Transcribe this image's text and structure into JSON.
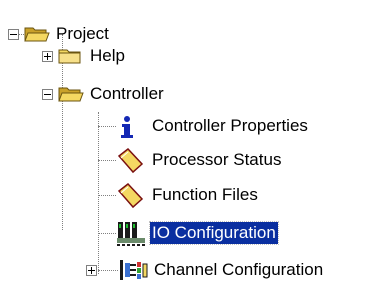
{
  "tree": {
    "project": {
      "label": "Project",
      "icon": "folder-open-icon",
      "expanded": true
    },
    "help": {
      "label": "Help",
      "icon": "folder-icon",
      "expanded": false
    },
    "controller": {
      "label": "Controller",
      "icon": "folder-open-icon",
      "expanded": true
    },
    "items": [
      {
        "label": "Controller Properties",
        "icon": "info-icon"
      },
      {
        "label": "Processor Status",
        "icon": "document-diamond-icon"
      },
      {
        "label": "Function Files",
        "icon": "document-diamond-icon"
      },
      {
        "label": "IO Configuration",
        "icon": "io-module-icon",
        "selected": true
      },
      {
        "label": "Channel Configuration",
        "icon": "channel-config-icon",
        "expanded": false
      }
    ]
  },
  "colors": {
    "selection": "#0a2fa0",
    "folder": "#f2d35a",
    "info": "#1428b4"
  }
}
